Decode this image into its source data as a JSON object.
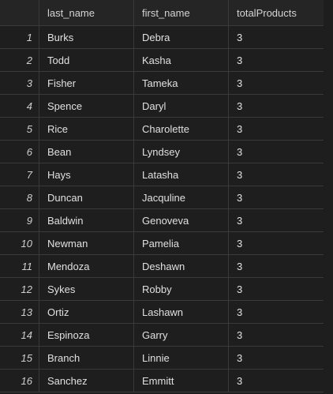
{
  "columns": {
    "last_name": "last_name",
    "first_name": "first_name",
    "totalProducts": "totalProducts"
  },
  "rows": [
    {
      "idx": "1",
      "last_name": "Burks",
      "first_name": "Debra",
      "totalProducts": "3"
    },
    {
      "idx": "2",
      "last_name": "Todd",
      "first_name": "Kasha",
      "totalProducts": "3"
    },
    {
      "idx": "3",
      "last_name": "Fisher",
      "first_name": "Tameka",
      "totalProducts": "3"
    },
    {
      "idx": "4",
      "last_name": "Spence",
      "first_name": "Daryl",
      "totalProducts": "3"
    },
    {
      "idx": "5",
      "last_name": "Rice",
      "first_name": "Charolette",
      "totalProducts": "3"
    },
    {
      "idx": "6",
      "last_name": "Bean",
      "first_name": "Lyndsey",
      "totalProducts": "3"
    },
    {
      "idx": "7",
      "last_name": "Hays",
      "first_name": "Latasha",
      "totalProducts": "3"
    },
    {
      "idx": "8",
      "last_name": "Duncan",
      "first_name": "Jacquline",
      "totalProducts": "3"
    },
    {
      "idx": "9",
      "last_name": "Baldwin",
      "first_name": "Genoveva",
      "totalProducts": "3"
    },
    {
      "idx": "10",
      "last_name": "Newman",
      "first_name": "Pamelia",
      "totalProducts": "3"
    },
    {
      "idx": "11",
      "last_name": "Mendoza",
      "first_name": "Deshawn",
      "totalProducts": "3"
    },
    {
      "idx": "12",
      "last_name": "Sykes",
      "first_name": "Robby",
      "totalProducts": "3"
    },
    {
      "idx": "13",
      "last_name": "Ortiz",
      "first_name": "Lashawn",
      "totalProducts": "3"
    },
    {
      "idx": "14",
      "last_name": "Espinoza",
      "first_name": "Garry",
      "totalProducts": "3"
    },
    {
      "idx": "15",
      "last_name": "Branch",
      "first_name": "Linnie",
      "totalProducts": "3"
    },
    {
      "idx": "16",
      "last_name": "Sanchez",
      "first_name": "Emmitt",
      "totalProducts": "3"
    }
  ]
}
